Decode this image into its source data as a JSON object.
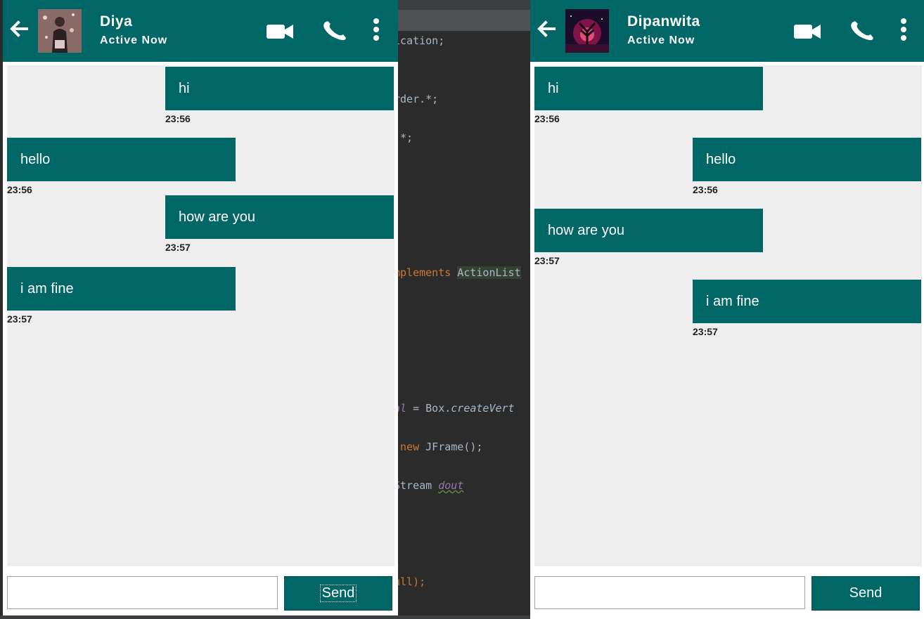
{
  "ide": {
    "lines": [
      "ication;",
      "rder.*;",
      ".*;",
      "mplements ",
      "ActionList",
      "al",
      " = Box.",
      "createVert",
      " new ",
      "JFrame();",
      "Stream ",
      "dout",
      "ull);"
    ]
  },
  "left_chat": {
    "name": "Diya",
    "status": "Active Now",
    "messages": [
      {
        "text": "hi",
        "time": "23:56",
        "side": "right"
      },
      {
        "text": "hello",
        "time": "23:56",
        "side": "left"
      },
      {
        "text": "how are you",
        "time": "23:57",
        "side": "right"
      },
      {
        "text": "i am fine",
        "time": "23:57",
        "side": "left"
      }
    ],
    "input_value": "",
    "send_label": "Send"
  },
  "right_chat": {
    "name": "Dipanwita",
    "status": "Active Now",
    "messages": [
      {
        "text": "hi",
        "time": "23:56",
        "side": "left"
      },
      {
        "text": "hello",
        "time": "23:56",
        "side": "right"
      },
      {
        "text": "how are you",
        "time": "23:57",
        "side": "left"
      },
      {
        "text": "i am fine",
        "time": "23:57",
        "side": "right"
      }
    ],
    "input_value": "",
    "send_label": "Send"
  },
  "icons": [
    "back-arrow-icon",
    "video-call-icon",
    "phone-icon",
    "more-vertical-icon"
  ],
  "colors": {
    "header": "#006666",
    "bubble": "#006666",
    "chat_bg": "#eeeeee"
  }
}
